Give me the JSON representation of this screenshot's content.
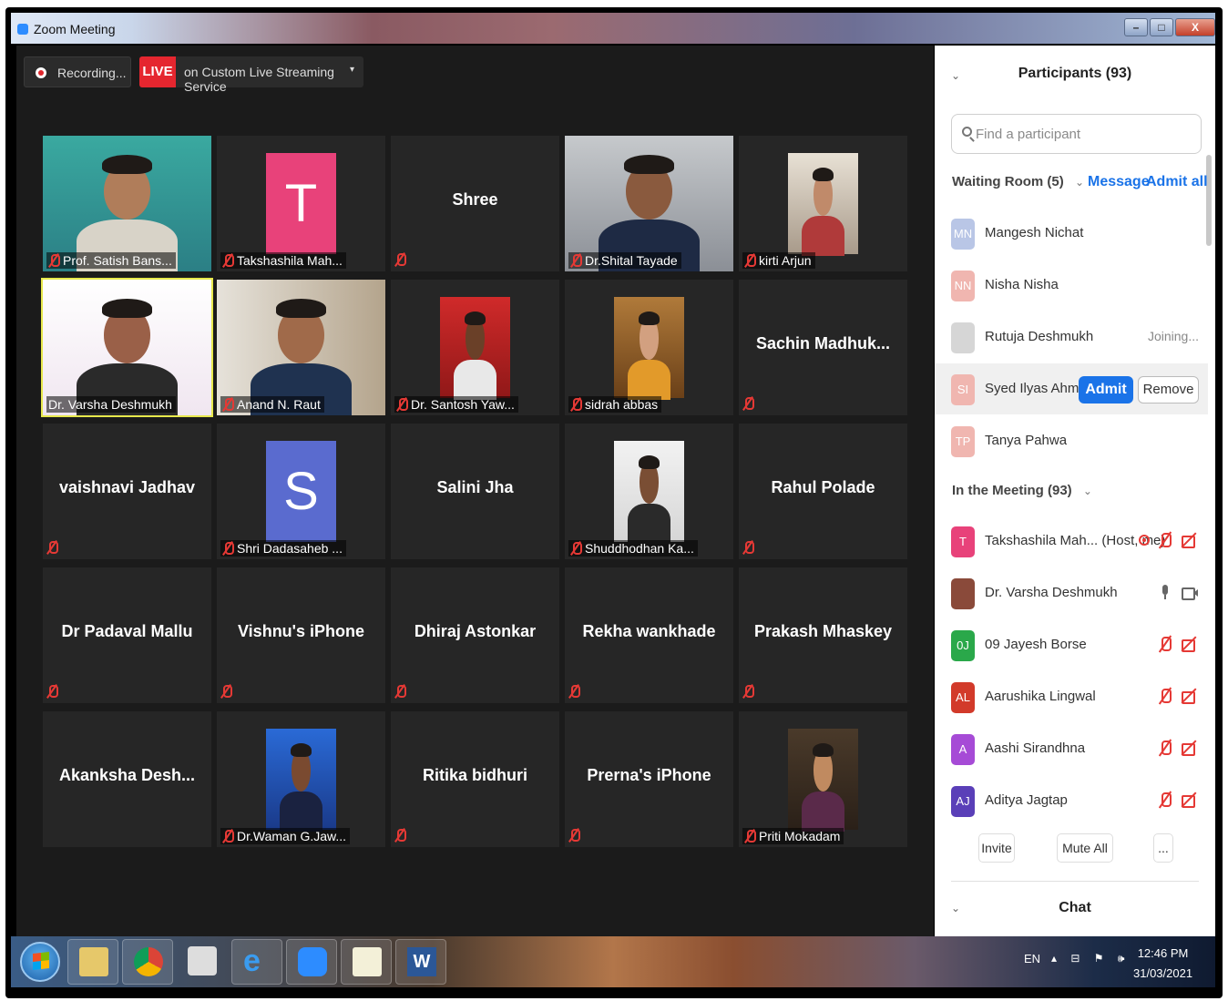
{
  "window": {
    "title": "Zoom Meeting",
    "min_label": "–",
    "max_label": "□",
    "close_label": "X"
  },
  "toolbar": {
    "recording_label": "Recording...",
    "live_badge": "LIVE",
    "live_text": "on Custom Live Streaming Service",
    "live_caret": "▾"
  },
  "tiles": [
    {
      "name": "Prof. Satish Bans...",
      "kind": "video",
      "muted": true
    },
    {
      "name": "Takshashila Mah...",
      "kind": "avatar",
      "letter": "T",
      "color": "#e8427a",
      "muted": true
    },
    {
      "name": "Shree",
      "kind": "text",
      "muted": true
    },
    {
      "name": "Dr.Shital Tayade",
      "kind": "video",
      "muted": true
    },
    {
      "name": "kirti Arjun",
      "kind": "photo",
      "muted": true
    },
    {
      "name": "Dr. Varsha Deshmukh",
      "kind": "video",
      "muted": false,
      "active": true
    },
    {
      "name": "Anand N. Raut",
      "kind": "video",
      "muted": true
    },
    {
      "name": "Dr. Santosh Yaw...",
      "kind": "photo",
      "muted": true
    },
    {
      "name": "sidrah abbas",
      "kind": "photo",
      "muted": true
    },
    {
      "name": "Sachin  Madhuk...",
      "kind": "text",
      "muted": true
    },
    {
      "name": "vaishnavi Jadhav",
      "kind": "text",
      "muted": true
    },
    {
      "name": "Shri Dadasaheb ...",
      "kind": "avatar",
      "letter": "S",
      "color": "#5a6bcf",
      "muted": true
    },
    {
      "name": "Salini Jha",
      "kind": "text",
      "muted": false
    },
    {
      "name": "Shuddhodhan Ka...",
      "kind": "photo",
      "muted": true
    },
    {
      "name": "Rahul Polade",
      "kind": "text",
      "muted": true
    },
    {
      "name": "Dr Padaval Mallu",
      "kind": "text",
      "muted": true
    },
    {
      "name": "Vishnu's iPhone",
      "kind": "text",
      "muted": true
    },
    {
      "name": "Dhiraj Astonkar",
      "kind": "text",
      "muted": true
    },
    {
      "name": "Rekha wankhade",
      "kind": "text",
      "muted": true
    },
    {
      "name": "Prakash Mhaskey",
      "kind": "text",
      "muted": true
    },
    {
      "name": "Akanksha  Desh...",
      "kind": "text",
      "muted": false
    },
    {
      "name": "Dr.Waman G.Jaw...",
      "kind": "photo",
      "muted": true
    },
    {
      "name": "Ritika bidhuri",
      "kind": "text",
      "muted": true
    },
    {
      "name": "Prerna's iPhone",
      "kind": "text",
      "muted": true
    },
    {
      "name": "Priti Mokadam",
      "kind": "photo",
      "muted": true
    }
  ],
  "panel": {
    "title": "Participants (93)",
    "collapse_icon": "chevron-down-icon",
    "search_placeholder": "Find a participant",
    "waiting_room": {
      "label": "Waiting Room (5)",
      "message": "Message",
      "admit_all": "Admit all",
      "people": [
        {
          "initials": "MN",
          "name": "Mangesh Nichat",
          "color": "#b9c6e6",
          "status": ""
        },
        {
          "initials": "NN",
          "name": "Nisha Nisha",
          "color": "#f0b6b0",
          "status": ""
        },
        {
          "initials": "",
          "name": "Rutuja Deshmukh",
          "color": "#d6d6d6",
          "status": "Joining..."
        },
        {
          "initials": "SI",
          "name": "Syed Ilyas Ahmed",
          "color": "#f0b6b0",
          "status": ""
        },
        {
          "initials": "TP",
          "name": "Tanya Pahwa",
          "color": "#f0b6b0",
          "status": ""
        }
      ],
      "admit_label": "Admit",
      "remove_label": "Remove"
    },
    "in_meeting": {
      "label": "In the Meeting (93)",
      "people": [
        {
          "initials": "T",
          "name": "Takshashila Mah...",
          "suffix": "(Host, me)",
          "color": "#e8427a",
          "mic": "off",
          "cam": "off",
          "rec": true
        },
        {
          "initials": "",
          "name": "Dr. Varsha Deshmukh",
          "suffix": "",
          "color": "#8a4a3a",
          "mic": "on",
          "cam": "on",
          "rec": false
        },
        {
          "initials": "0J",
          "name": "09 Jayesh Borse",
          "suffix": "",
          "color": "#2aa84a",
          "mic": "off",
          "cam": "off",
          "rec": false
        },
        {
          "initials": "AL",
          "name": "Aarushika Lingwal",
          "suffix": "",
          "color": "#d23a2a",
          "mic": "off",
          "cam": "off",
          "rec": false
        },
        {
          "initials": "A",
          "name": "Aashi Sirandhna",
          "suffix": "",
          "color": "#a64bd6",
          "mic": "off",
          "cam": "off",
          "rec": false
        },
        {
          "initials": "AJ",
          "name": "Aditya Jagtap",
          "suffix": "",
          "color": "#5a3fb8",
          "mic": "off",
          "cam": "off",
          "rec": false
        }
      ]
    },
    "invite": "Invite",
    "mute_all": "Mute All",
    "more": "...",
    "chat": "Chat"
  },
  "taskbar": {
    "lang": "EN",
    "tray": "▴ ⊟ ⚑ 🕪",
    "time": "12:46 PM",
    "date": "31/03/2021"
  }
}
